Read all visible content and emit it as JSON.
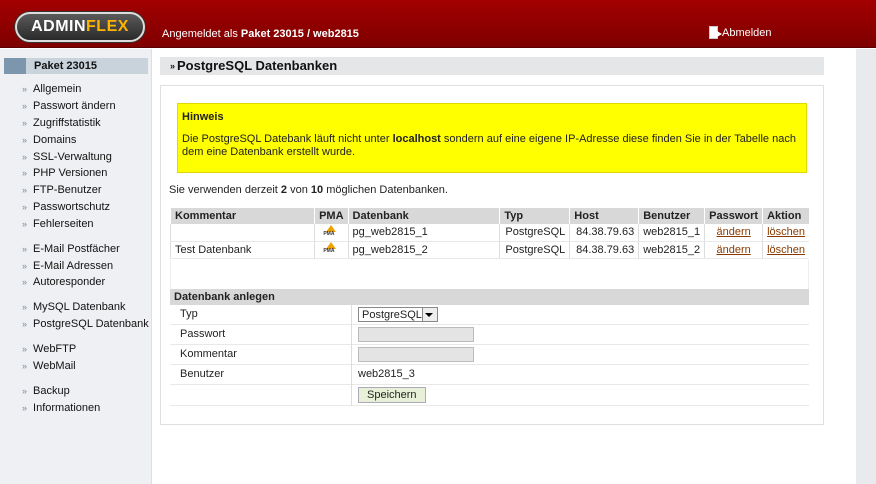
{
  "header": {
    "logo_part1": "ADMIN",
    "logo_part2": "FLEX",
    "login_prefix": "Angemeldet als",
    "login_user": "Paket 23015 / web2815",
    "logout_label": "Abmelden"
  },
  "sidebar": {
    "heading": "Paket 23015",
    "items": [
      {
        "label": "Allgemein"
      },
      {
        "label": "Passwort ändern"
      },
      {
        "label": "Zugriffstatistik"
      },
      {
        "label": "Domains"
      },
      {
        "label": "SSL-Verwaltung"
      },
      {
        "label": "PHP Versionen"
      },
      {
        "label": "FTP-Benutzer"
      },
      {
        "label": "Passwortschutz"
      },
      {
        "label": "Fehlerseiten"
      },
      {
        "label": "E-Mail Postfächer"
      },
      {
        "label": "E-Mail Adressen"
      },
      {
        "label": "Autoresponder"
      },
      {
        "label": "MySQL Datenbank"
      },
      {
        "label": "PostgreSQL Datenbank"
      },
      {
        "label": "WebFTP"
      },
      {
        "label": "WebMail"
      },
      {
        "label": "Backup"
      },
      {
        "label": "Informationen"
      }
    ]
  },
  "main": {
    "title": "PostgreSQL Datenbanken",
    "hint": {
      "title": "Hinweis",
      "text_before": "Die PostgreSQL Datebank läuft nicht unter",
      "text_bold": "localhost",
      "text_after": "sondern auf eine eigene IP-Adresse diese finden Sie in der Tabelle nach dem eine Datenbank erstellt wurde."
    },
    "usage": {
      "prefix": "Sie verwenden derzeit",
      "used": "2",
      "middle": "von",
      "max": "10",
      "suffix": "möglichen Datenbanken."
    },
    "table": {
      "headers": [
        "Kommentar",
        "PMA",
        "Datenbank",
        "Typ",
        "Host",
        "Benutzer",
        "Passwort",
        "Aktion"
      ],
      "rows": [
        {
          "kommentar": "",
          "pma_icon": "phpmyadmin-icon",
          "datenbank": "pg_web2815_1",
          "typ": "PostgreSQL",
          "host": "84.38.79.63",
          "benutzer": "web2815_1",
          "passwort": "ändern",
          "aktion": "löschen"
        },
        {
          "kommentar": "Test Datenbank",
          "pma_icon": "phpmyadmin-icon",
          "datenbank": "pg_web2815_2",
          "typ": "PostgreSQL",
          "host": "84.38.79.63",
          "benutzer": "web2815_2",
          "passwort": "ändern",
          "aktion": "löschen"
        }
      ]
    },
    "create": {
      "heading": "Datenbank anlegen",
      "typ_label": "Typ",
      "typ_value": "PostgreSQL",
      "passwort_label": "Passwort",
      "passwort_value": "",
      "kommentar_label": "Kommentar",
      "kommentar_value": "",
      "benutzer_label": "Benutzer",
      "benutzer_value": "web2815_3",
      "save_label": "Speichern"
    }
  },
  "colors": {
    "header_red": "#8b0000",
    "hint_yellow": "#ffff00",
    "link_brown": "#8a3a00"
  }
}
